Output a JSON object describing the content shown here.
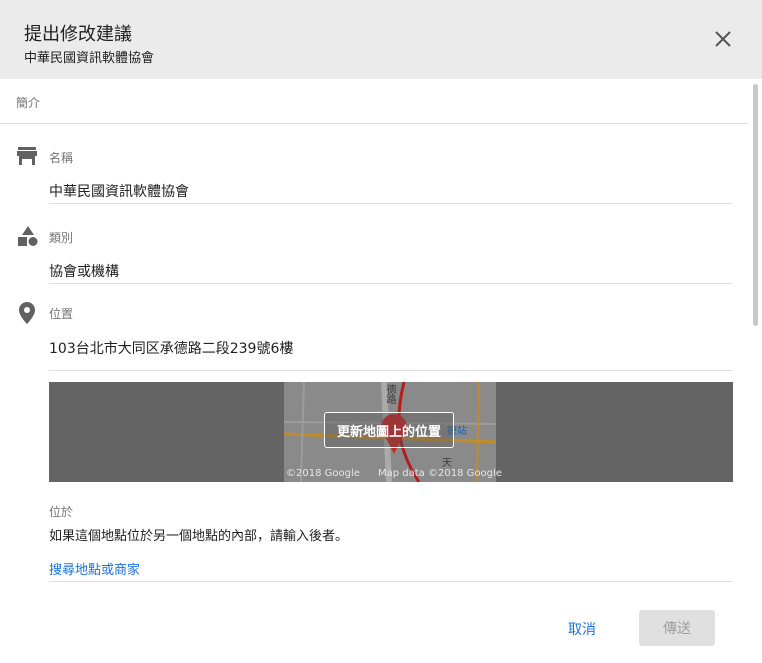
{
  "header": {
    "title": "提出修改建議",
    "subtitle": "中華民國資訊軟體協會",
    "close_icon": "close-icon"
  },
  "section": {
    "label": "簡介"
  },
  "fields": {
    "name": {
      "icon": "store-icon",
      "label": "名稱",
      "value": "中華民國資訊軟體協會"
    },
    "category": {
      "icon": "shapes-icon",
      "label": "類別",
      "value": "協會或機構"
    },
    "location": {
      "icon": "location-pin-icon",
      "label": "位置",
      "value": "103台北市大同区承德路二段239號6樓"
    }
  },
  "map": {
    "button_label": "更新地圖上的位置",
    "credit_left": "©2018 Google",
    "credit_right": "Map data ©2018 Google",
    "road_text_1": "德路",
    "road_text_2": "捷站",
    "road_text_3": "天"
  },
  "within": {
    "label": "位於",
    "description": "如果這個地點位於另一個地點的內部，請輸入後者。",
    "search_placeholder": "搜尋地點或商家"
  },
  "actions": {
    "cancel_label": "取消",
    "submit_label": "傳送"
  },
  "colors": {
    "header_bg": "#ebebeb",
    "accent": "#1a73e8",
    "pin": "#e53935",
    "map_overlay": "#646464"
  }
}
